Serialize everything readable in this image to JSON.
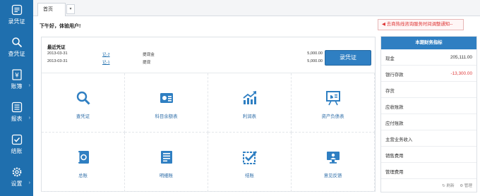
{
  "sidebar": {
    "items": [
      {
        "label": "录凭证",
        "icon": "voucher-entry-icon"
      },
      {
        "label": "查凭证",
        "icon": "search-voucher-icon"
      },
      {
        "label": "账簿",
        "icon": "yen-ledger-icon"
      },
      {
        "label": "报表",
        "icon": "report-icon"
      },
      {
        "label": "结账",
        "icon": "checkout-icon"
      },
      {
        "label": "设置",
        "icon": "gear-icon"
      }
    ],
    "arrow": "›"
  },
  "tabs": {
    "home": "首页",
    "dropdown": "▾"
  },
  "greeting": "下午好，体验用户!",
  "notice": "◀ 去商热线咨询服务时间调整通知--",
  "recent": {
    "title": "最近凭证",
    "rows": [
      {
        "date": "2013-03-31",
        "no": "记-2",
        "desc": "提现金",
        "amount": "5,000.00"
      },
      {
        "date": "2013-03-31",
        "no": "记-1",
        "desc": "提现",
        "amount": "5,000.00"
      }
    ],
    "record_button": "录凭证"
  },
  "grid": [
    {
      "label": "查凭证",
      "icon": "magnifier-icon"
    },
    {
      "label": "科目余额表",
      "icon": "account-balance-icon"
    },
    {
      "label": "利润表",
      "icon": "trend-chart-icon"
    },
    {
      "label": "资产负债表",
      "icon": "presentation-board-icon"
    },
    {
      "label": "总账",
      "icon": "ledger-book-icon"
    },
    {
      "label": "明细账",
      "icon": "detail-ledger-icon"
    },
    {
      "label": "结账",
      "icon": "checked-box-icon"
    },
    {
      "label": "意见反馈",
      "icon": "feedback-monitor-icon"
    }
  ],
  "finance": {
    "title": "本期财务指标",
    "rows": [
      {
        "label": "现金",
        "value": "205,111.00"
      },
      {
        "label": "银行存款",
        "value": "-13,300.00"
      },
      {
        "label": "存货",
        "value": ""
      },
      {
        "label": "应收账款",
        "value": ""
      },
      {
        "label": "应付账款",
        "value": ""
      },
      {
        "label": "主营业务收入",
        "value": ""
      },
      {
        "label": "销售费用",
        "value": ""
      },
      {
        "label": "管理费用",
        "value": ""
      }
    ],
    "refresh": "↻ 刷新",
    "manage": "⚙ 管理"
  },
  "colors": {
    "sidebar": "#1f6fae",
    "accent": "#2f7fc2",
    "negative": "#e03b3b"
  }
}
